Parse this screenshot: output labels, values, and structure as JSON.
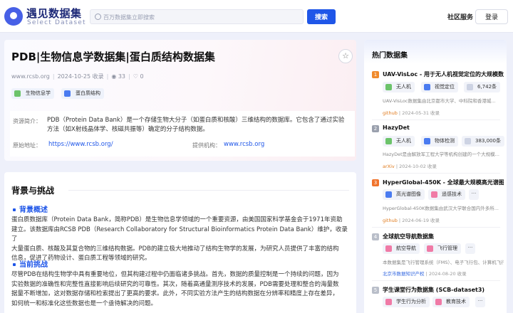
{
  "header": {
    "logo_title": "遇见数据集",
    "logo_subtitle": "Select Dataset",
    "search_placeholder": "百万数据集立即搜索",
    "search_button": "搜索",
    "community_label": "社区服务",
    "login_button": "登录"
  },
  "dataset": {
    "title": "PDB|生物信息学数据集|蛋白质结构数据集",
    "source_site": "www.rcsb.org",
    "date": "2024-10-25 收录",
    "views": "33",
    "favorites": "0",
    "tags": [
      "生物信息学",
      "蛋白质结构"
    ],
    "intro_label": "资源简介：",
    "intro_text_line1": "PDB（Protein Data Bank）是一个存储生物大分子（如蛋白质和核酸）三维结构的数据库。它包含了通过实验",
    "intro_text_line2": "方法（如X射线晶体学、核磁共振等）确定的分子结构数据。",
    "origin_label": "原始地址：",
    "origin_url": "https://www.rcsb.org/",
    "provider_label": "提供机构：",
    "provider_value": "www.rcsb.org"
  },
  "content": {
    "section_title": "背景与挑战",
    "overview_title": "背景概述",
    "overview_lines": [
      "蛋白质数据库（Protein Data Bank，简称PDB）是生物信息学领域的一个重要资源，由美国国家科学基金会于1971年资助",
      "建立。该数据库由RCSB PDB（Research Collaboratory for Structural Bioinformatics Protein Data Bank）维护，收录了",
      "大量蛋白质、核酸及其复合物的三维结构数据。PDB的建立极大地推动了结构生物学的发展，为研究人员提供了丰富的结构",
      "信息，促进了药物设计、蛋白质工程等领域的研究。"
    ],
    "challenge_title": "当前挑战",
    "challenge_lines": [
      "尽管PDB在结构生物学中具有重要地位，但其构建过程中仍面临诸多挑战。首先，数据的质量控制是一个持续的问题，因为",
      "实验数据的准确性和完整性直接影响后续研究的可靠性。其次，随着高通量测序技术的发展，PDB需要处理和整合的海量数",
      "据量不断增加，这对数据存储和检索提出了更高的要求。此外，不同实验方法产生的结构数据在分辨率和精度上存在差异，",
      "如何统一和标准化这些数据也是一个亟待解决的问题。"
    ]
  },
  "sidebar": {
    "title": "热门数据集",
    "items": [
      {
        "rank": "1",
        "title": "UAV-VisLoc - 用于无人机视觉定位的大规模数据集",
        "tags": [
          "无人机",
          "视觉定位"
        ],
        "count": "6,742条",
        "desc": "UAV-VisLoc数据集由北京都市大学、中科院和香港城...",
        "source": "github",
        "date": "2024-05-31 收录"
      },
      {
        "rank": "2",
        "title": "HazyDet",
        "tags": [
          "无人机",
          "物体检测"
        ],
        "count": "383,000条",
        "desc": "HazyDet是由解放军工程大学等机构创建的一个大规模...",
        "source": "arXiv",
        "date": "2024-10-02 收录"
      },
      {
        "rank": "3",
        "title": "HyperGlobal-450K - 全球最大规模高光谱图像数...",
        "tags": [
          "高光谱图像",
          "遥感技术"
        ],
        "more": "···",
        "desc": "HyperGlobal-450K数据集由武汉大学联合国内外多所...",
        "source": "github",
        "date": "2024-06-19 收录"
      },
      {
        "rank": "4",
        "title": "全球航空导航数据集",
        "tags": [
          "航空导航",
          "飞行管理"
        ],
        "more": "···",
        "desc": "本数据集是飞行管理系统（FMS）、电子飞行包、计算机飞行计...",
        "source": "北京市数据知识产权",
        "date": "2024-08-20 收录"
      },
      {
        "rank": "5",
        "title": "学生课堂行为数据集 (SCB-dataset3)",
        "tags": [
          "学生行为分析",
          "教育技术"
        ],
        "more": "···"
      }
    ]
  },
  "colors": {
    "brand": "#1f56e8",
    "rank1": "#f08a2c",
    "rank2": "#9aa0ad",
    "rank3": "#f0732c",
    "tag_green": "#6cc36a",
    "tag_blue": "#4a7bf0",
    "tag_pink": "#f07aa6"
  }
}
